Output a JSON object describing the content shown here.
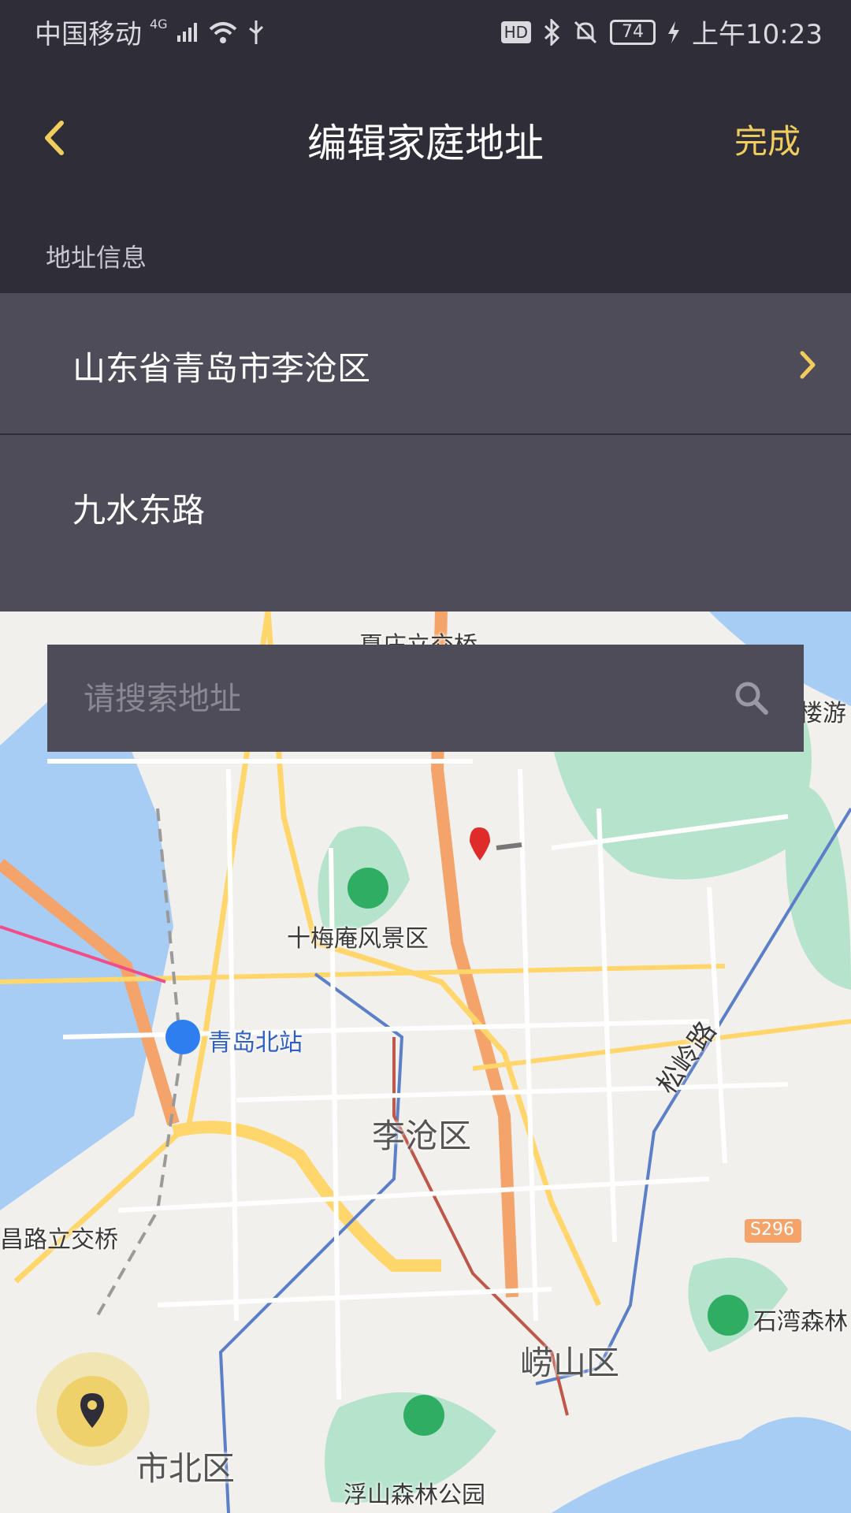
{
  "status_bar": {
    "carrier": "中国移动",
    "network": "4G",
    "hd_badge": "HD",
    "battery": "74",
    "time": "上午10:23"
  },
  "header": {
    "title": "编辑家庭地址",
    "done_label": "完成",
    "back_icon": "chevron-left-icon"
  },
  "section": {
    "label": "地址信息"
  },
  "address": {
    "region": "山东省青岛市李沧区",
    "street": "九水东路"
  },
  "search": {
    "placeholder": "请搜索地址"
  },
  "map": {
    "labels": {
      "interchange_top": "夏庄立交桥",
      "scenic_area": "十梅庵风景区",
      "station": "青岛北站",
      "district_licang": "李沧区",
      "road_name": "松岭路",
      "interchange_left": "昌路立交桥",
      "highway": "S296",
      "district_laoshan": "崂山区",
      "forest_right": "石湾森林",
      "district_shibei": "市北区",
      "forest_park": "浮山森林公园",
      "tower_right": "楼游"
    }
  },
  "colors": {
    "background": "#2f2d38",
    "panel": "#4e4c58",
    "accent": "#f0cd5c"
  }
}
